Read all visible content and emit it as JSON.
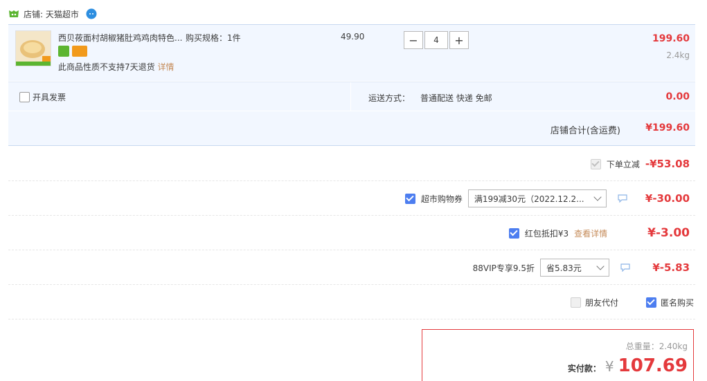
{
  "shop": {
    "label": "店铺: 天猫超市"
  },
  "item": {
    "title": "西贝莜面村胡椒猪肚鸡鸡肉特色...",
    "spec": "购买规格：1件",
    "unit_price": "49.90",
    "quantity": "4",
    "minus_label": "−",
    "plus_label": "+",
    "total": "199.60",
    "weight": "2.4kg",
    "note": "此商品性质不支持7天退货",
    "note_link": "详情"
  },
  "shipping": {
    "invoice_label": "开具发票",
    "method_label": "运送方式：",
    "method_value": "普通配送 快递 免邮",
    "fee": "0.00"
  },
  "shop_total": {
    "label": "店铺合计(含运费)",
    "value": "¥199.60"
  },
  "discounts": {
    "instant": {
      "label": "下单立减",
      "amount": "-¥53.08"
    },
    "coupon": {
      "label": "超市购物券",
      "select": "满199减30元（2022.12.2...",
      "amount": "¥-30.00"
    },
    "redpacket": {
      "label": "红包抵扣¥3",
      "link": "查看详情",
      "amount": "¥-3.00"
    },
    "vip": {
      "label": "88VIP专享9.5折",
      "select": "省5.83元",
      "amount": "¥-5.83"
    }
  },
  "options": {
    "proxy_pay": "朋友代付",
    "anonymous": "匿名购买"
  },
  "summary": {
    "total_weight": "总重量：2.40kg",
    "pay_label": "实付款：",
    "currency": "¥",
    "pay_amount": "107.69"
  },
  "colors": {
    "price_red": "#e4393c",
    "accent_blue": "#4d7ef0",
    "row_bg": "#f2f7ff",
    "link": "#c58b59"
  }
}
